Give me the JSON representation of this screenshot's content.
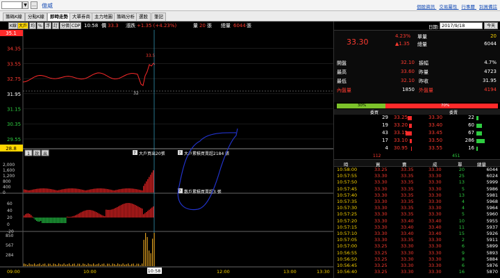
{
  "topbar": {
    "stock_code": "",
    "stock_name": "億威",
    "links": [
      "個股資訊",
      "交易屬性",
      "行事曆",
      "別買備註"
    ]
  },
  "tabs": [
    "籌碼K線",
    "分點K線",
    "即時走勢",
    "大單券商",
    "主力地圖",
    "籌碼分析",
    "選股",
    "筆記"
  ],
  "active_tab": 2,
  "toolbar": {
    "buttons": [
      "K線",
      "大戶",
      "均",
      "%",
      "浮",
      "訂",
      "分價",
      "CDP"
    ],
    "active_button": 1,
    "time": "10:58",
    "price_label": "價",
    "price": "33.3",
    "change_label": "漲跌",
    "change": "+1.35 (+4.23%)",
    "volume_label": "量",
    "volume": "20",
    "volume_unit": "張",
    "total_label": "總量",
    "total": "6044",
    "total_unit": "張"
  },
  "chart": {
    "price_ticks": [
      "35.1",
      "34.35",
      "33.55",
      "32.75",
      "31.95",
      "31.15",
      "30.35",
      "29.55",
      "28.8"
    ],
    "high_label": "33.5",
    "low_label": "32",
    "sub_buttons": [
      "1",
      "說",
      "出"
    ],
    "big_net_label": "大戶買出20張",
    "retail_label": "大戶累積買賣超2184 張",
    "net_label": "散戶累積買賣超3 張",
    "big_net_ticks": [
      "2,000",
      "1,600",
      "1,200",
      "800",
      "400",
      "0"
    ],
    "net_ticks": [
      "60",
      "40",
      "20",
      "0",
      "-20"
    ],
    "vol_ticks": [
      "850",
      "567",
      "284"
    ],
    "time_ticks": [
      "09:00",
      "10:00",
      "12:00",
      "13:00",
      "13:30"
    ],
    "cursor_time": "10:58",
    "annotation_color": "#2233cc"
  },
  "right": {
    "date_label": "日期:",
    "date": "2017/9/18",
    "today_btn": "今天",
    "price": "33.30",
    "pct": "4.23%",
    "change": "▲1.35",
    "single_label": "單量",
    "single": "20",
    "total_label": "總量",
    "total": "6044",
    "rows": [
      {
        "l1": "開盤",
        "v1": "32.10",
        "l2": "振幅",
        "v2": "4.7%"
      },
      {
        "l1": "最高",
        "v1": "33.60",
        "l2": "昨量",
        "v2": "4723"
      },
      {
        "l1": "最低",
        "v1": "32.10",
        "l2": "昨收",
        "v2": "31.95"
      },
      {
        "l1": "內盤量",
        "v1": "1850",
        "l2": "外盤量",
        "v2": "4194"
      }
    ],
    "inner_pct": "30%",
    "outer_pct": "70%",
    "inner_fraction": 0.3,
    "book_head": [
      "委買",
      "委賣"
    ],
    "book": [
      {
        "bq": "29",
        "bp": "33.25",
        "ap": "33.30",
        "aq": "22"
      },
      {
        "bq": "19",
        "bp": "33.20",
        "ap": "33.40",
        "aq": "60"
      },
      {
        "bq": "43",
        "bp": "33.15",
        "ap": "33.45",
        "aq": "67"
      },
      {
        "bq": "17",
        "bp": "33.10",
        "ap": "33.50",
        "aq": "286"
      },
      {
        "bq": "4",
        "bp": "30.95",
        "ap": "33.55",
        "aq": "16"
      }
    ],
    "book_bid_total": "112",
    "book_ask_total": "451",
    "trade_head": [
      "時",
      "買",
      "賣",
      "成",
      "單",
      "總量"
    ],
    "trades": [
      {
        "t": "10:58:00",
        "b": "33.25",
        "s": "33.35",
        "p": "33.30",
        "q": "20",
        "tot": "6044"
      },
      {
        "t": "10:57:55",
        "b": "33.30",
        "s": "33.35",
        "p": "33.30",
        "q": "25",
        "tot": "6024"
      },
      {
        "t": "10:57:50",
        "b": "33.30",
        "s": "33.35",
        "p": "33.30",
        "q": "13",
        "tot": "5999"
      },
      {
        "t": "10:57:45",
        "b": "33.30",
        "s": "33.35",
        "p": "33.30",
        "q": "5",
        "tot": "5986"
      },
      {
        "t": "10:57:40",
        "b": "33.30",
        "s": "33.35",
        "p": "33.30",
        "q": "13",
        "tot": "5981"
      },
      {
        "t": "10:57:35",
        "b": "33.30",
        "s": "33.35",
        "p": "33.30",
        "q": "4",
        "tot": "5968"
      },
      {
        "t": "10:57:30",
        "b": "33.30",
        "s": "33.35",
        "p": "33.30",
        "q": "4",
        "tot": "5964"
      },
      {
        "t": "10:57:25",
        "b": "33.30",
        "s": "33.35",
        "p": "33.30",
        "q": "5",
        "tot": "5960"
      },
      {
        "t": "10:57:20",
        "b": "33.30",
        "s": "33.40",
        "p": "33.40",
        "q": "10",
        "tot": "5955"
      },
      {
        "t": "10:57:15",
        "b": "33.30",
        "s": "33.40",
        "p": "33.40",
        "q": "11",
        "tot": "5937"
      },
      {
        "t": "10:57:10",
        "b": "33.30",
        "s": "33.40",
        "p": "33.40",
        "q": "15",
        "tot": "5926"
      },
      {
        "t": "10:57:05",
        "b": "33.30",
        "s": "33.35",
        "p": "33.30",
        "q": "2",
        "tot": "5911"
      },
      {
        "t": "10:57:00",
        "b": "33.25",
        "s": "33.30",
        "p": "33.30",
        "q": "6",
        "tot": "5899"
      },
      {
        "t": "10:56:55",
        "b": "33.25",
        "s": "33.30",
        "p": "33.30",
        "q": "9",
        "tot": "5893"
      },
      {
        "t": "10:56:50",
        "b": "33.25",
        "s": "33.30",
        "p": "33.30",
        "q": "8",
        "tot": "5884"
      },
      {
        "t": "10:56:45",
        "b": "33.25",
        "s": "33.30",
        "p": "33.30",
        "q": "6",
        "tot": "5876"
      },
      {
        "t": "10:56:40",
        "b": "33.25",
        "s": "33.30",
        "p": "33.30",
        "q": "16",
        "tot": "5870"
      }
    ]
  }
}
